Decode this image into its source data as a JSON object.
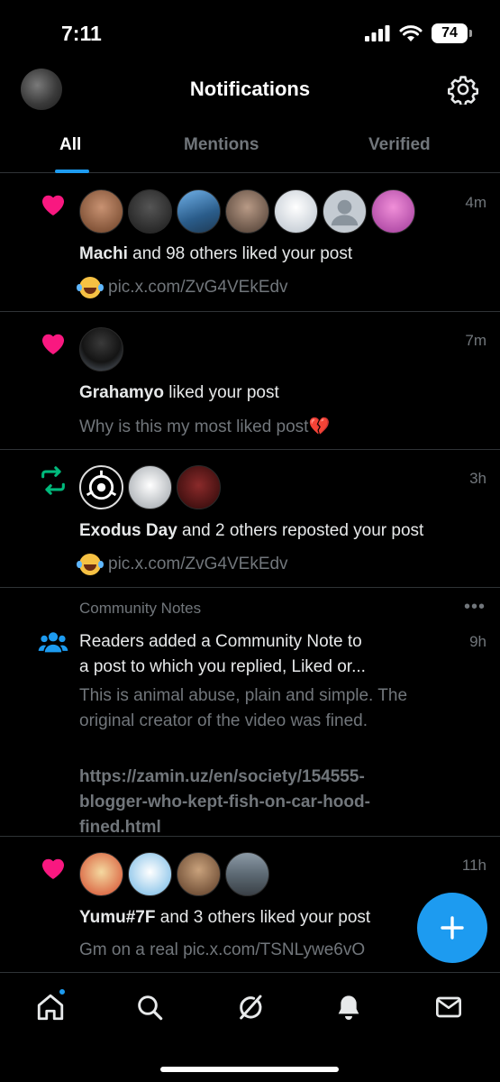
{
  "status_bar": {
    "time": "7:11",
    "battery": "74"
  },
  "header": {
    "title": "Notifications"
  },
  "tabs": [
    {
      "label": "All"
    },
    {
      "label": "Mentions"
    },
    {
      "label": "Verified"
    }
  ],
  "notifications": [
    {
      "type": "like",
      "icon": "heart-icon",
      "time": "4m",
      "actor": "Machi",
      "text": " and 98 others liked your post",
      "sub": "pic.x.com/ZvG4VEkEdv",
      "avatar_colors": [
        "#8b5a3c",
        "#2b2b2b",
        "#3a6fb0",
        "#6b5a4a",
        "#d8dde2",
        "#c0c6cc",
        "#c84fb0"
      ]
    },
    {
      "type": "like",
      "icon": "heart-icon",
      "time": "7m",
      "actor": "Grahamyo",
      "text": " liked your post",
      "sub": "Why is this my most liked post💔"
    },
    {
      "type": "repost",
      "icon": "repost-icon",
      "time": "3h",
      "actor": "Exodus Day",
      "text": " and 2 others reposted your post",
      "sub": "pic.x.com/ZvG4VEkEdv"
    },
    {
      "type": "community_note",
      "icon": "people-icon",
      "label": "Community Notes",
      "time": "9h",
      "line1": "Readers added a Community Note to",
      "line2": "a post to which you replied, Liked or...",
      "note1": "This is animal abuse, plain and simple. The",
      "note2": "original creator of the video was fined.",
      "link1": "https://zamin.uz/en/society/154555-",
      "link2": "blogger-who-kept-fish-on-car-hood-",
      "link3": "fined.html"
    },
    {
      "type": "like",
      "icon": "heart-icon",
      "time": "11h",
      "actor": "Yumu#7F",
      "text": " and 3 others liked your post",
      "sub": "Gm on a real pic.x.com/TSNLywe6vO"
    }
  ],
  "colors": {
    "accent": "#1d9bf0",
    "like": "#f91880",
    "repost": "#00ba7c",
    "muted": "#71767b"
  }
}
